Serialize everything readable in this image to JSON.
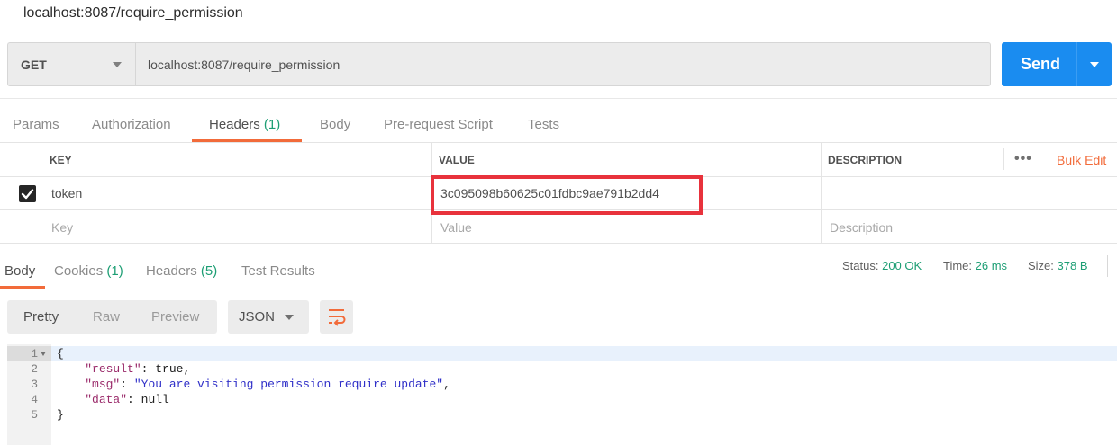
{
  "window": {
    "title": "localhost:8087/require_permission"
  },
  "request": {
    "method": "GET",
    "url": "localhost:8087/require_permission",
    "send_label": "Send"
  },
  "request_tabs": [
    {
      "label": "Params"
    },
    {
      "label": "Authorization"
    },
    {
      "label": "Headers",
      "count": "(1)",
      "active": true
    },
    {
      "label": "Body"
    },
    {
      "label": "Pre-request Script"
    },
    {
      "label": "Tests"
    }
  ],
  "headers_table": {
    "columns": [
      "KEY",
      "VALUE",
      "DESCRIPTION"
    ],
    "more_icon": "ellipsis-icon",
    "bulk_edit": "Bulk Edit",
    "rows": [
      {
        "checked": true,
        "key": "token",
        "value": "3c095098b60625c01fdbc9ae791b2dd4",
        "description": ""
      }
    ],
    "placeholder": {
      "key": "Key",
      "value": "Value",
      "description": "Description"
    },
    "highlight_color": "#e8323c"
  },
  "response_tabs": [
    {
      "label": "Body",
      "active": true
    },
    {
      "label": "Cookies",
      "count": "(1)"
    },
    {
      "label": "Headers",
      "count": "(5)"
    },
    {
      "label": "Test Results"
    }
  ],
  "status_bar": {
    "status_label": "Status:",
    "status_value": "200 OK",
    "time_label": "Time:",
    "time_value": "26 ms",
    "size_label": "Size:",
    "size_value": "378 B"
  },
  "response_toolbar": {
    "views": [
      "Pretty",
      "Raw",
      "Preview"
    ],
    "format": "JSON",
    "wrap_icon": "wrap-lines-icon"
  },
  "response_body": {
    "line_numbers": [
      "1",
      "2",
      "3",
      "4",
      "5"
    ],
    "open_brace": "{",
    "close_brace": "}",
    "fields": [
      {
        "key": "\"result\"",
        "value": "true"
      },
      {
        "key": "\"msg\"",
        "value": "\"You are visiting permission require update\""
      },
      {
        "key": "\"data\"",
        "value": "null"
      }
    ]
  },
  "colors": {
    "accent": "#f26b3a",
    "send_button": "#1a8cf0",
    "count_green": "#1d9e74"
  }
}
